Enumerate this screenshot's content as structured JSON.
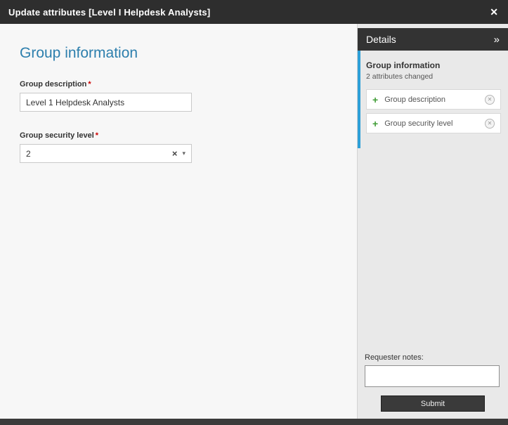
{
  "titlebar": {
    "title": "Update attributes [Level I Helpdesk Analysts]"
  },
  "icons": {
    "close": "✕",
    "collapse": "»",
    "clear": "×",
    "dropdown": "▾",
    "remove": "✕"
  },
  "main": {
    "heading": "Group information",
    "fields": [
      {
        "label": "Group description",
        "required": "*",
        "value": "Level 1 Helpdesk Analysts"
      },
      {
        "label": "Group security level",
        "required": "*",
        "value": "2"
      }
    ]
  },
  "sidebar": {
    "header": {
      "title": "Details"
    },
    "changes": {
      "section_title": "Group information",
      "summary": "2 attributes changed",
      "items": [
        {
          "icon": "+",
          "label": "Group description"
        },
        {
          "icon": "+",
          "label": "Group security level"
        }
      ]
    },
    "notes": {
      "label": "Requester notes:",
      "value": ""
    },
    "submit_label": "Submit"
  },
  "colors": {
    "titlebar_bg": "#2e2e2e",
    "heading_blue": "#2d7fad",
    "required_red": "#cc0000",
    "accent_blue": "#2da0d8",
    "plus_green": "#3f9c35",
    "submit_bg": "#3a3a3a"
  }
}
